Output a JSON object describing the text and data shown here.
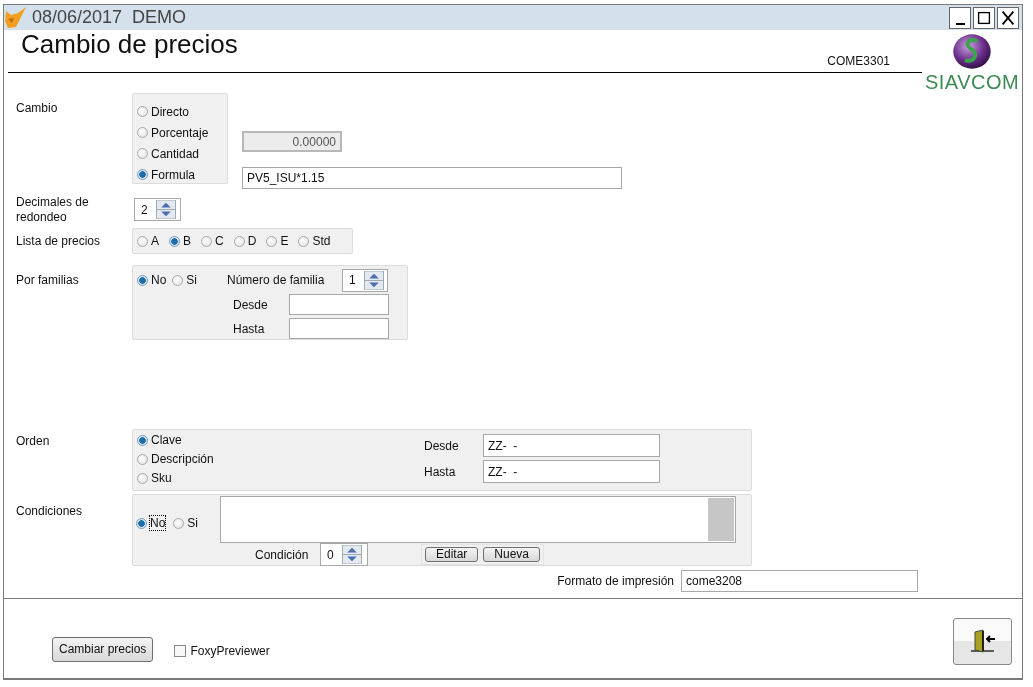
{
  "window": {
    "title": "08/06/2017  DEMO"
  },
  "header": {
    "title": "Cambio de precios",
    "code": "COME3301",
    "logo_text": "SIAVCOM"
  },
  "cambio": {
    "label": "Cambio",
    "options": [
      {
        "label": "Directo",
        "selected": false
      },
      {
        "label": "Porcentaje",
        "selected": false
      },
      {
        "label": "Cantidad",
        "selected": false
      },
      {
        "label": "Formula",
        "selected": true
      }
    ],
    "amount": "0.00000",
    "amount_disabled": true,
    "formula": "PV5_ISU*1.15"
  },
  "decimales": {
    "label": "Decimales de redondeo",
    "value": "2"
  },
  "lista": {
    "label": "Lista de precios",
    "options": [
      {
        "label": "A",
        "selected": false
      },
      {
        "label": "B",
        "selected": true
      },
      {
        "label": "C",
        "selected": false
      },
      {
        "label": "D",
        "selected": false
      },
      {
        "label": "E",
        "selected": false
      },
      {
        "label": "Std",
        "selected": false
      }
    ]
  },
  "familias": {
    "label": "Por familias",
    "options": [
      {
        "label": "No",
        "selected": true
      },
      {
        "label": "Si",
        "selected": false
      }
    ],
    "numero_label": "Número de familia",
    "numero": "1",
    "desde_label": "Desde",
    "hasta_label": "Hasta"
  },
  "orden": {
    "label": "Orden",
    "options": [
      {
        "label": "Clave",
        "selected": true
      },
      {
        "label": "Descripción",
        "selected": false
      },
      {
        "label": "Sku",
        "selected": false
      }
    ],
    "desde_label": "Desde",
    "desde": "ZZ-  -",
    "hasta_label": "Hasta",
    "hasta": "ZZ-  -"
  },
  "condiciones": {
    "label": "Condiciones",
    "options": [
      {
        "label": "No",
        "selected": true,
        "focused": true
      },
      {
        "label": "Si",
        "selected": false,
        "focused": false
      }
    ],
    "condicion_label": "Condición",
    "condicion": "0",
    "buttons": [
      "Editar",
      "Nueva"
    ]
  },
  "formato": {
    "label": "Formato de impresión",
    "value": "come3208"
  },
  "footer": {
    "button": "Cambiar precios",
    "preview": {
      "label": "FoxyPreviewer",
      "checked": false
    }
  }
}
